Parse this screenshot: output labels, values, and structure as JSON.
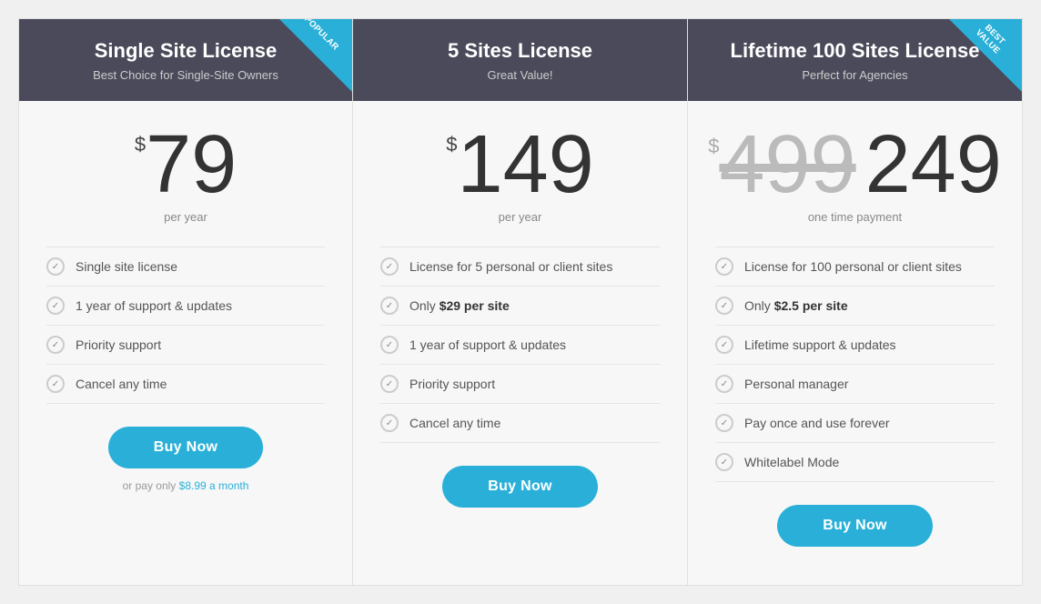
{
  "plans": [
    {
      "id": "single",
      "header_title": "Single Site License",
      "header_subtitle": "Best Choice for Single-Site Owners",
      "badge": "POPULAR",
      "currency": "$",
      "price": "79",
      "old_price": null,
      "period": "per year",
      "features": [
        {
          "text": "Single site license",
          "bold_part": null
        },
        {
          "text": "1 year of support & updates",
          "bold_part": null
        },
        {
          "text": "Priority support",
          "bold_part": null
        },
        {
          "text": "Cancel any time",
          "bold_part": null
        }
      ],
      "btn_label": "Buy Now",
      "note": "or pay only $8.99 a month",
      "note_highlight": "$8.99 a month"
    },
    {
      "id": "five-sites",
      "header_title": "5 Sites License",
      "header_subtitle": "Great Value!",
      "badge": null,
      "currency": "$",
      "price": "149",
      "old_price": null,
      "period": "per year",
      "features": [
        {
          "text": "License for 5 personal or client sites",
          "bold_part": null
        },
        {
          "text": "Only $29 per site",
          "bold_part": "$29 per site"
        },
        {
          "text": "1 year of support & updates",
          "bold_part": null
        },
        {
          "text": "Priority support",
          "bold_part": null
        },
        {
          "text": "Cancel any time",
          "bold_part": null
        }
      ],
      "btn_label": "Buy Now",
      "note": null
    },
    {
      "id": "lifetime",
      "header_title": "Lifetime 100 Sites License",
      "header_subtitle": "Perfect for Agencies",
      "badge": "BEST VALUE",
      "currency": "$",
      "price": "249",
      "old_price": "499",
      "period": "one time payment",
      "features": [
        {
          "text": "License for 100 personal or client sites",
          "bold_part": null
        },
        {
          "text": "Only $2.5 per site",
          "bold_part": "$2.5 per site"
        },
        {
          "text": "Lifetime support & updates",
          "bold_part": null
        },
        {
          "text": "Personal manager",
          "bold_part": null
        },
        {
          "text": "Pay once and use forever",
          "bold_part": null
        },
        {
          "text": "Whitelabel Mode",
          "bold_part": null
        }
      ],
      "btn_label": "Buy Now",
      "note": null
    }
  ]
}
